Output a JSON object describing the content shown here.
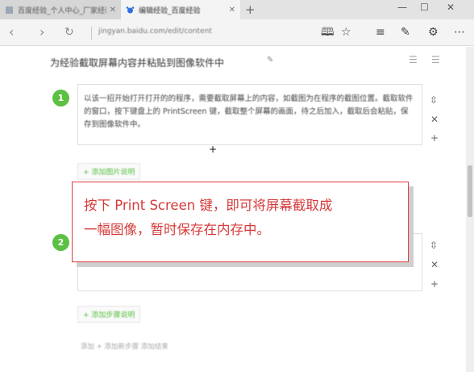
{
  "tabs": [
    {
      "title": "百度经验_个人中心_厂家经验",
      "active": false
    },
    {
      "title": "编辑经验_百度经验",
      "active": true
    }
  ],
  "window": {
    "minimize": "—",
    "restore": "☐",
    "close": "✕"
  },
  "nav": {
    "url": "jingyan.baidu.com/edit/content"
  },
  "content": {
    "title": "为经验截取屏幕内容并粘贴到图像软件中",
    "steps": [
      {
        "num": "1",
        "text": "以该一招开始打开打开的的程序，需要截取屏幕上的内容，如截图为在程序的截图位置。截取软件的窗口，按下键盘上的 PrintScreen 键，截取整个屏幕的画面，待之后加入，截取后会粘贴，保存到图像软件中。"
      },
      {
        "num": "2",
        "text": ""
      }
    ],
    "add_image": "+ 添加图片说明",
    "add_step_btn": "+ 添加步骤说明",
    "add_step": "添加 +  添加新步骤 添加结束"
  },
  "callout": {
    "line1": "按下 Print Screen 键，即可将屏幕截取成",
    "line2": "一幅图像，暂时保存在内存中。"
  },
  "colors": {
    "accent_green": "#5bc043",
    "callout_red": "#d63a3a"
  }
}
